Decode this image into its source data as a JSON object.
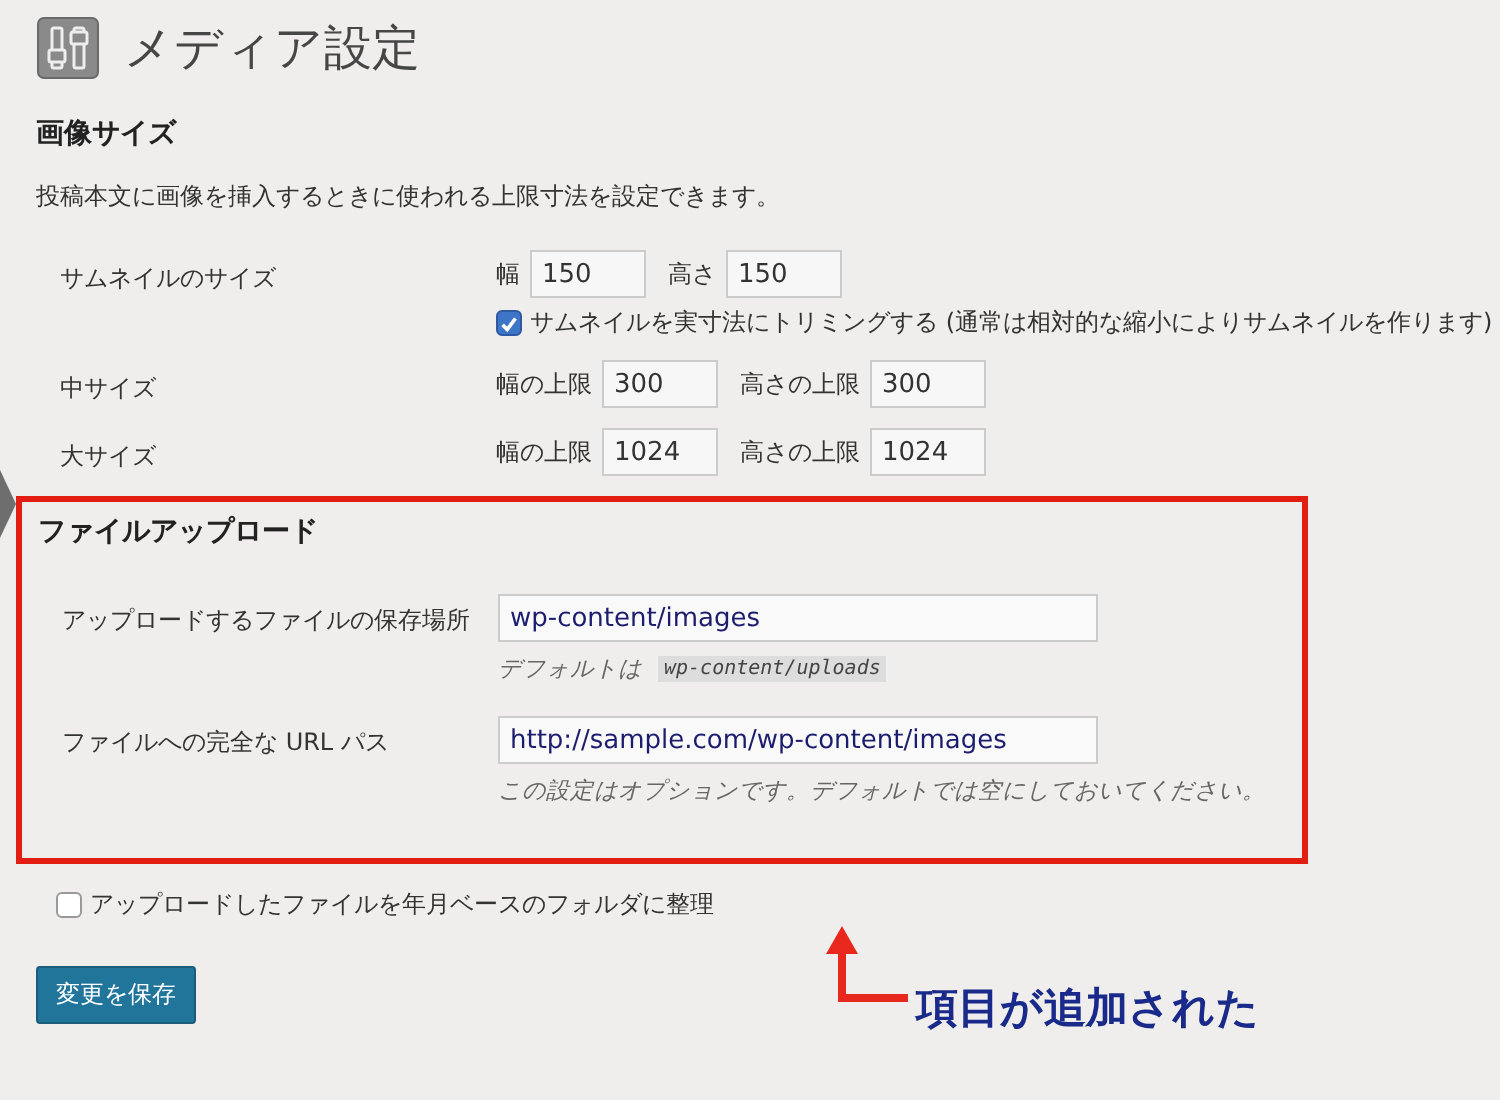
{
  "title": "メディア設定",
  "image_sizes": {
    "heading": "画像サイズ",
    "description": "投稿本文に画像を挿入するときに使われる上限寸法を設定できます。",
    "rows": [
      {
        "label": "サムネイルのサイズ",
        "fields": [
          {
            "label": "幅",
            "value": "150"
          },
          {
            "label": "高さ",
            "value": "150"
          }
        ],
        "crop": {
          "label": "サムネイルを実寸法にトリミングする (通常は相対的な縮小によりサムネイルを作ります)",
          "checked": true
        }
      },
      {
        "label": "中サイズ",
        "fields": [
          {
            "label": "幅の上限",
            "value": "300"
          },
          {
            "label": "高さの上限",
            "value": "300"
          }
        ]
      },
      {
        "label": "大サイズ",
        "fields": [
          {
            "label": "幅の上限",
            "value": "1024"
          },
          {
            "label": "高さの上限",
            "value": "1024"
          }
        ]
      }
    ]
  },
  "upload": {
    "heading": "ファイルアップロード",
    "rows": [
      {
        "label": "アップロードするファイルの保存場所",
        "value": "wp-content/images",
        "hint": "デフォルトは",
        "hint_code": "wp-content/uploads"
      },
      {
        "label": "ファイルへの完全な URL パス",
        "value": "http://sample.com/wp-content/images",
        "hint": "この設定はオプションです。デフォルトでは空にしておいてください。"
      }
    ]
  },
  "organize": {
    "label": "アップロードしたファイルを年月ベースのフォルダに整理",
    "checked": false
  },
  "save_button": "変更を保存",
  "annotation": "項目が追加された"
}
